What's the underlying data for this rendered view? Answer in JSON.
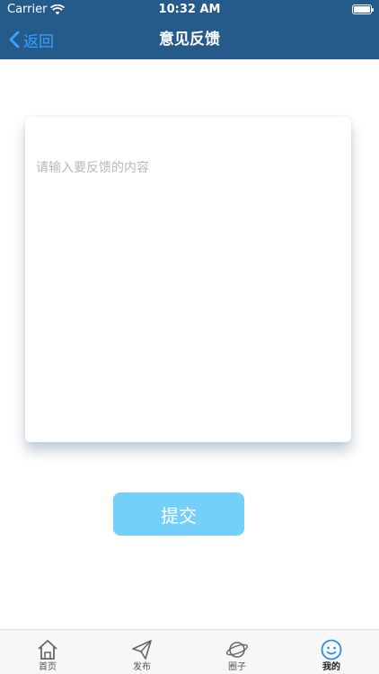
{
  "status_bar": {
    "carrier": "Carrier",
    "time": "10:32 AM"
  },
  "nav": {
    "back_label": "返回",
    "title": "意见反馈"
  },
  "feedback": {
    "placeholder": "请输入要反馈的内容",
    "value": ""
  },
  "submit_label": "提交",
  "tabs": [
    {
      "label": "首页",
      "icon": "home-icon"
    },
    {
      "label": "发布",
      "icon": "send-icon"
    },
    {
      "label": "圈子",
      "icon": "planet-icon"
    },
    {
      "label": "我的",
      "icon": "smiley-icon",
      "active": true
    }
  ],
  "colors": {
    "nav_background": "#245b8a",
    "back_accent": "#3aa0ff",
    "submit_button": "#74cff9",
    "active_tab_icon": "#2b8fe0"
  }
}
